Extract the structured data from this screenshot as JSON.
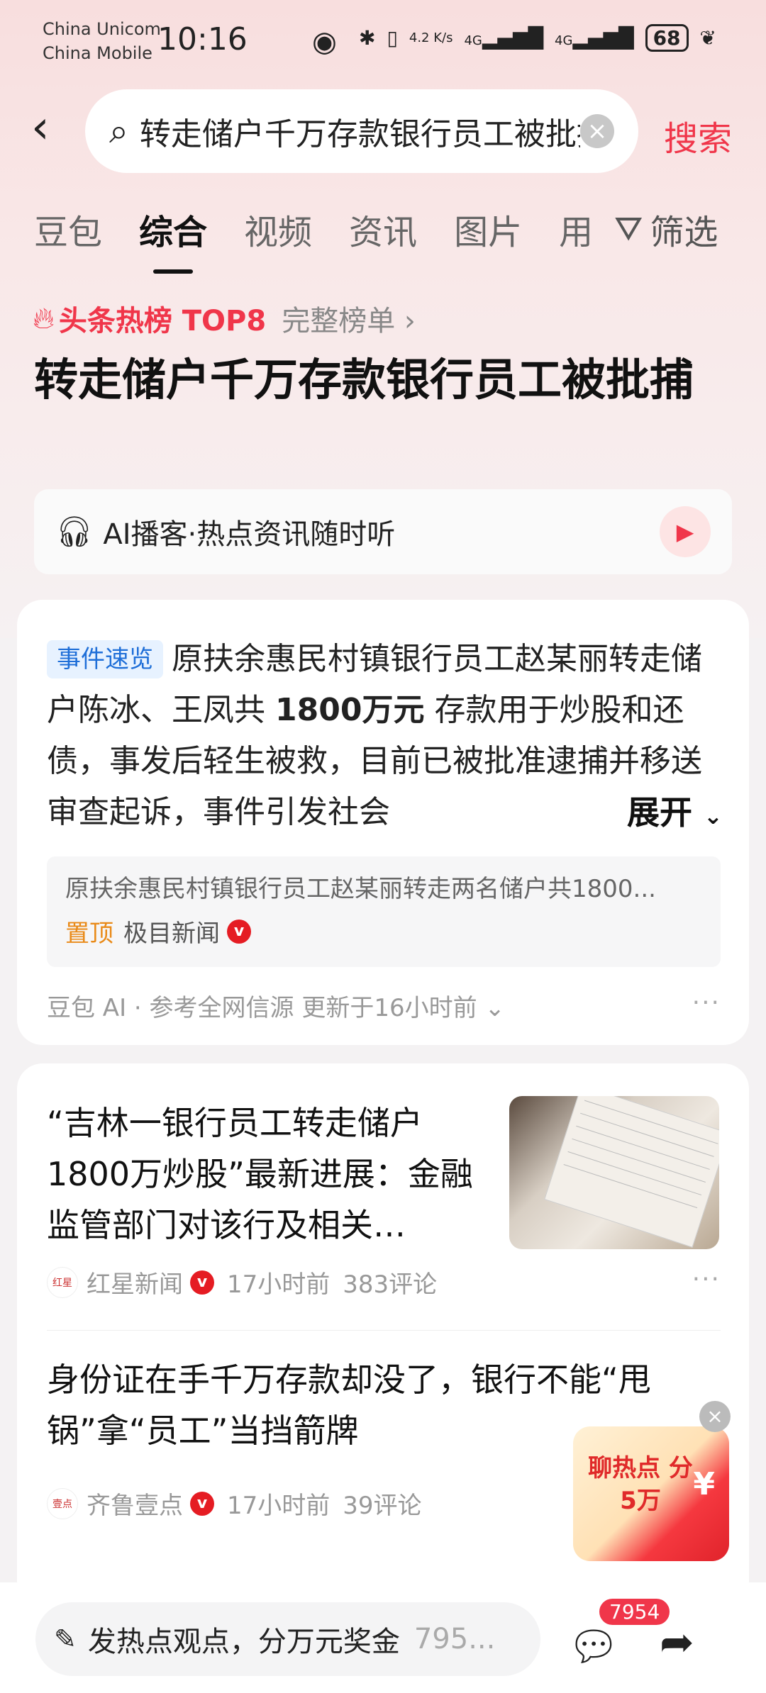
{
  "status_bar": {
    "carrier1": "China Unicom",
    "carrier2": "China Mobile",
    "time": "10:16",
    "net_speed": "4.2 K/s",
    "signal1": "4G",
    "signal2": "4G",
    "battery": "68"
  },
  "search": {
    "query": "转走储户千万存款银行员工被批捕",
    "button": "搜索"
  },
  "tabs": [
    {
      "label": "豆包"
    },
    {
      "label": "综合",
      "active": true
    },
    {
      "label": "视频"
    },
    {
      "label": "资讯"
    },
    {
      "label": "图片"
    },
    {
      "label": "用"
    }
  ],
  "filter_label": "筛选",
  "hot": {
    "title": "头条热榜 TOP8",
    "full_list": "完整榜单"
  },
  "headline": "转走储户千万存款银行员工被批捕",
  "podcast": {
    "label": "AI播客·热点资讯随时听"
  },
  "summary_card": {
    "tag": "事件速览",
    "text_before": "原扶余惠民村镇银行员工赵某丽转走储户陈冰、王凤共 ",
    "highlight": "1800万元",
    "text_after": " 存款用于炒股和还债，事发后轻生被救，目前已被批准逮捕并移送审查起诉，事件引发社会",
    "expand": "展开",
    "source_line": "原扶余惠民村镇银行员工赵某丽转走两名储户共1800...",
    "pin": "置顶",
    "source_name": "极目新闻",
    "footer": "豆包 AI · 参考全网信源 更新于16小时前"
  },
  "articles": [
    {
      "title": "“吉林一银行员工转走储户1800万炒股”最新进展：金融监管部门对该行及相关…",
      "source": "红星新闻",
      "time": "17小时前",
      "comments": "383评论"
    },
    {
      "title": "身份证在手千万存款却没了，银行不能“甩锅”拿“员工”当挡箭牌",
      "source": "齐鲁壹点",
      "time": "17小时前",
      "comments": "39评论"
    }
  ],
  "promo": {
    "text": "聊热点 分5万",
    "symbol": "¥"
  },
  "bottom_bar": {
    "placeholder": "发热点观点，分万元奖金",
    "count": "795...",
    "comment_badge": "7954"
  },
  "colors": {
    "accent_red": "#f0364a",
    "tag_blue": "#1f6fd8",
    "pin_orange": "#e98a18"
  }
}
